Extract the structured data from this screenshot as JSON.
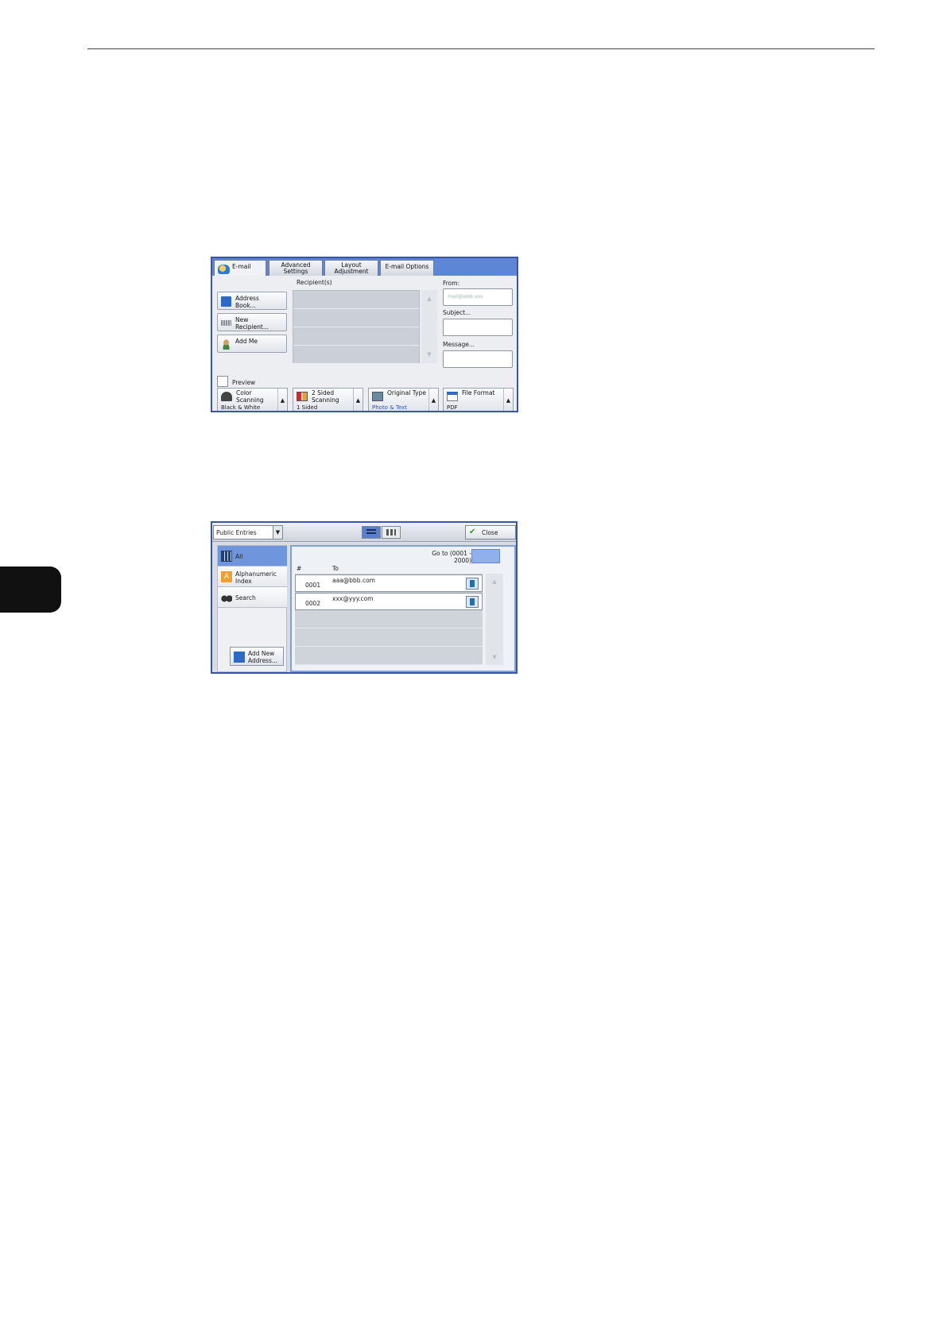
{
  "screen1": {
    "tabs": [
      {
        "label": "E-mail"
      },
      {
        "label": "Advanced Settings"
      },
      {
        "label": "Layout Adjustment"
      },
      {
        "label": "E-mail Options"
      }
    ],
    "side_buttons": {
      "address_book": "Address Book...",
      "new_recipient": "New Recipient...",
      "add_me": "Add Me",
      "preview": "Preview"
    },
    "recipients_label": "Recipient(s)",
    "from_label": "From:",
    "from_value": "mail@addr.xxx",
    "subject_label": "Subject...",
    "message_label": "Message...",
    "functions": [
      {
        "title": "Color Scanning",
        "value": "Black & White"
      },
      {
        "title": "2 Sided Scanning",
        "value": "1 Sided"
      },
      {
        "title": "Original Type",
        "value": "Photo & Text"
      },
      {
        "title": "File Format",
        "value": "PDF"
      }
    ]
  },
  "screen2": {
    "dropdown": "Public Entries",
    "close": "Close",
    "nav": {
      "all": "All",
      "alphanumeric": "Alphanumeric Index",
      "search": "Search"
    },
    "add_new_address": "Add New Address...",
    "goto_label": "Go to (0001 - 2000)",
    "col_hash": "#",
    "col_to": "To",
    "entries": [
      {
        "number": "0001",
        "address": "aaa@bbb.com"
      },
      {
        "number": "0002",
        "address": "xxx@yyy.com"
      }
    ]
  }
}
